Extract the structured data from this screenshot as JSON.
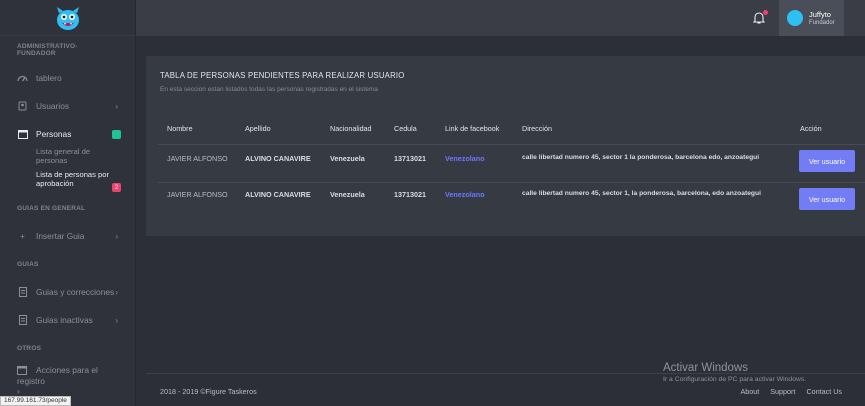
{
  "sidebar": {
    "section_admin": "ADMINISTRATIVO- FUNDADOR",
    "item_tablero": "tablero",
    "item_usuarios": "Usuarios",
    "item_personas": "Personas",
    "sub_lista_general": "Lista general de personas",
    "sub_lista_pendientes_1": "Lista de personas por",
    "sub_lista_pendientes_2": "aprobación",
    "sub_lista_pendientes_badge": "2",
    "section_guias_general": "GUIAS EN GENERAL",
    "item_insertar_guia": "Insertar Guia",
    "section_guias": "GUIAS",
    "item_guias_correcciones": "Guias y correcciones",
    "item_guias_inactivas": "Guias inactivas",
    "section_otros": "OTROS",
    "item_acciones_1": "Acciones para el",
    "item_acciones_2": "registro"
  },
  "topbar": {
    "user_name": "Juffyto",
    "user_role": "Fundador"
  },
  "card": {
    "title": "TABLA DE PERSONAS PENDIENTES PARA REALIZAR USUARIO",
    "subtitle": "En esta seccion estan listados todas las personas registradas en el sistema"
  },
  "table": {
    "headers": [
      "Nombre",
      "Apellido",
      "Nacionalidad",
      "Cedula",
      "Link de facebook",
      "Dirección",
      "Acción"
    ],
    "rows": [
      {
        "nombre": "JAVIER ALFONSO",
        "apellido": "ALVINO CANAVIRE",
        "nacionalidad": "Venezuela",
        "cedula": "13713021",
        "facebook": "Venezolano",
        "direccion": "calle libertad numero 45, sector 1 la ponderosa, barcelona edo, anzoategui",
        "accion": "Ver usuario"
      },
      {
        "nombre": "JAVIER ALFONSO",
        "apellido": "ALVINO CANAVIRE",
        "nacionalidad": "Venezuela",
        "cedula": "13713021",
        "facebook": "Venezolano",
        "direccion": "calle libertad numero 45, sector 1, la ponderosa, barcelona, edo anzoategui",
        "accion": "Ver usuario"
      }
    ]
  },
  "footer": {
    "copyright": "2018 - 2019 ©Figure Taskeros",
    "about": "About",
    "support": "Support",
    "contact": "Contact Us",
    "activate_title": "Activar Windows",
    "activate_sub": "Ir a Configuración de PC para activar Windows."
  },
  "status_url": "167.99.161.73/people",
  "colors": {
    "accent": "#727cf5",
    "link": "#6b77ff",
    "badge_green": "#21c197",
    "badge_red": "#f0436b"
  }
}
